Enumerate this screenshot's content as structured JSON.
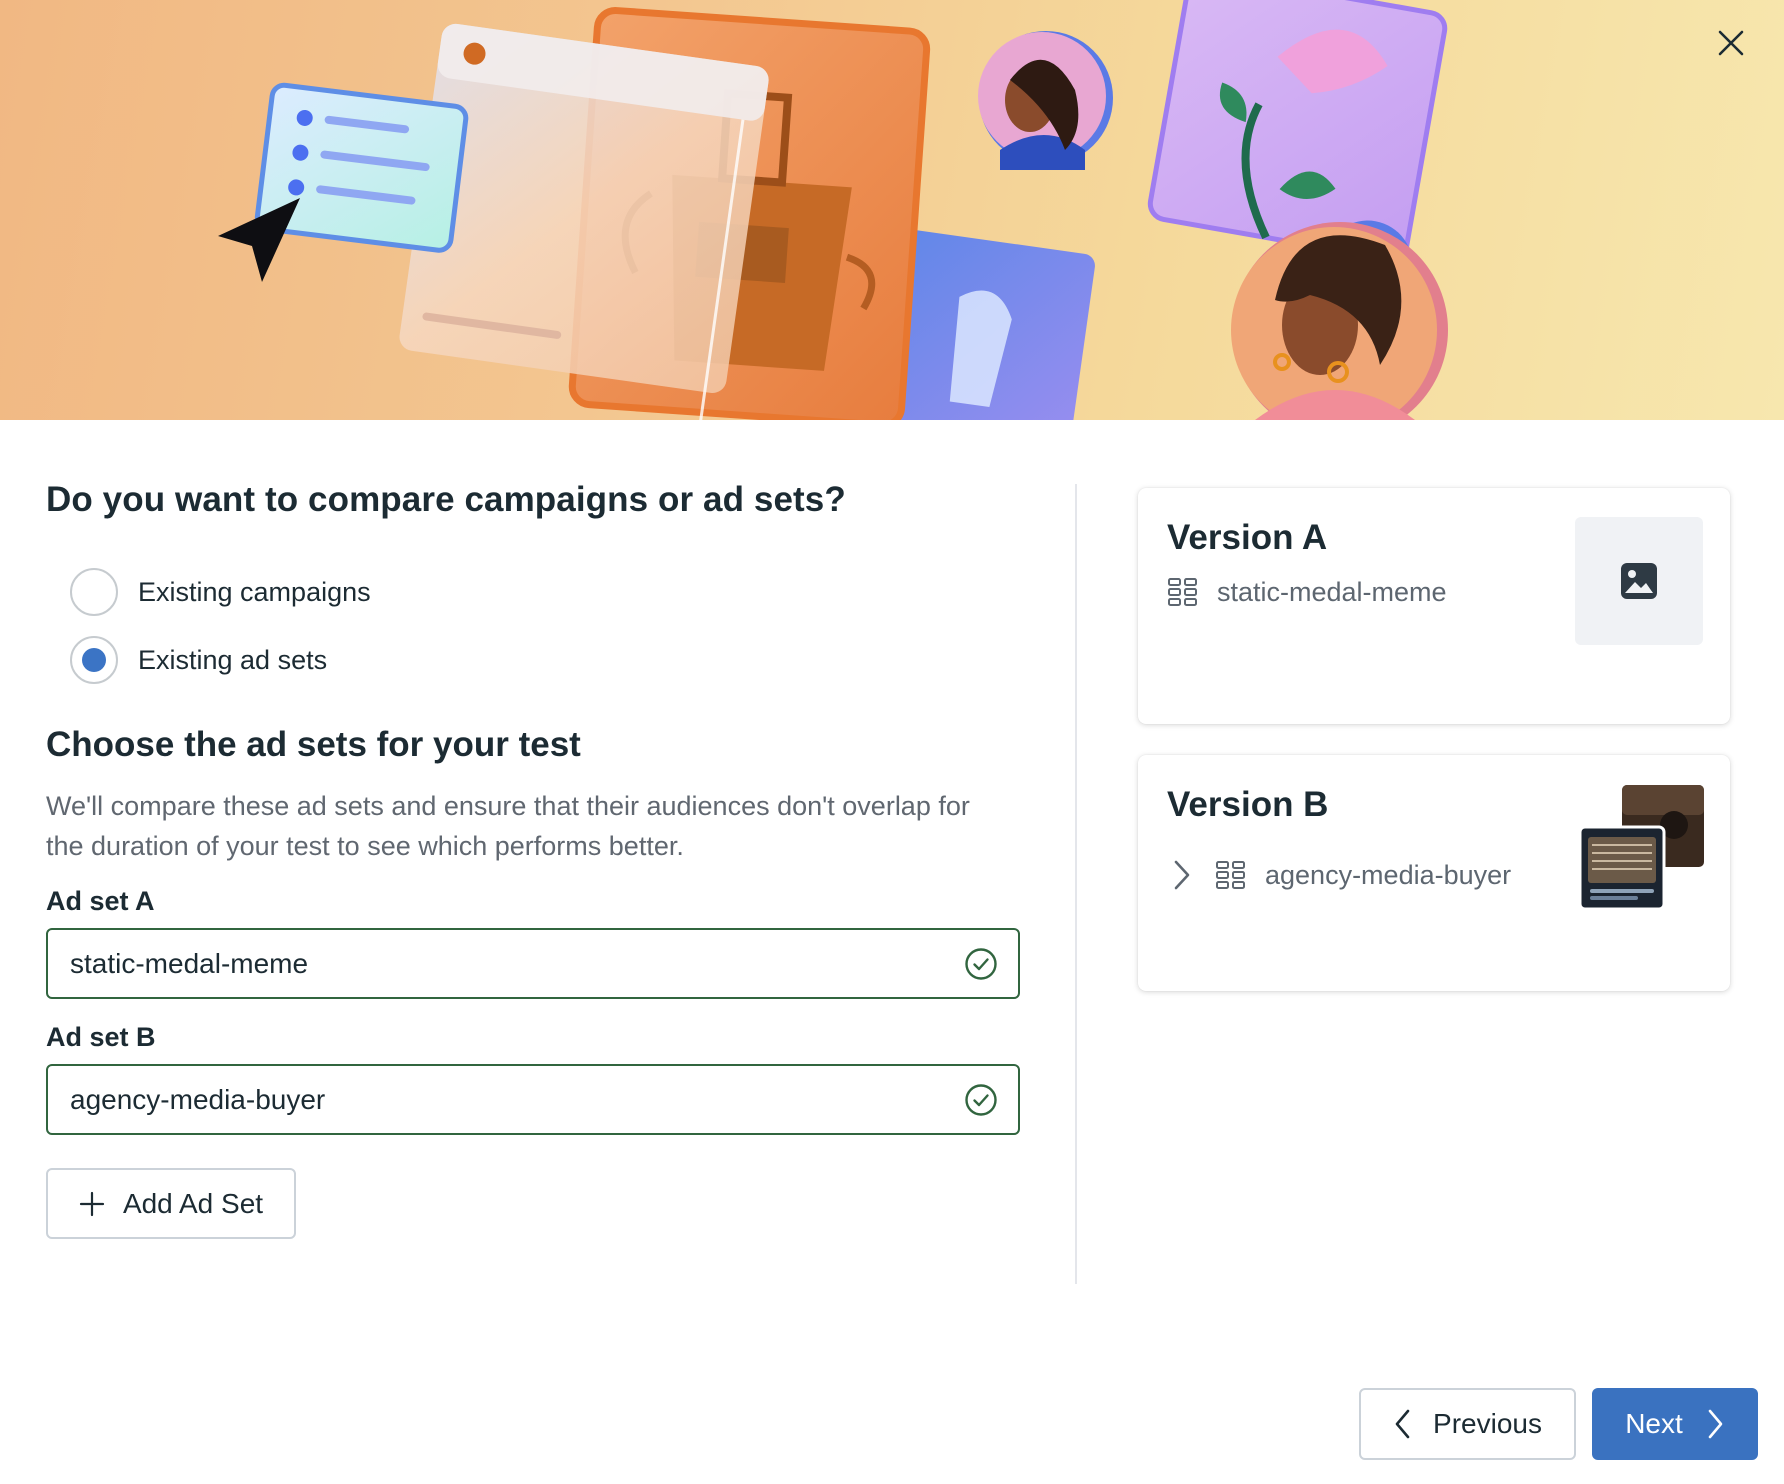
{
  "dialog": {
    "close_icon": "close-icon",
    "hero_illustration": "ad-creative-illustration"
  },
  "compare": {
    "question": "Do you want to compare campaigns or ad sets?",
    "options": [
      {
        "label": "Existing campaigns",
        "selected": false
      },
      {
        "label": "Existing ad sets",
        "selected": true
      }
    ]
  },
  "choose": {
    "title": "Choose the ad sets for your test",
    "description": "We'll compare these ad sets and ensure that their audiences don't overlap for the duration of your test to see which performs better.",
    "ad_set_a_label": "Ad set A",
    "ad_set_a_value": "static-medal-meme",
    "ad_set_b_label": "Ad set B",
    "ad_set_b_value": "agency-media-buyer",
    "valid_icon": "check-circle-icon",
    "add_button_label": "Add Ad Set",
    "add_icon": "plus-icon"
  },
  "versions": [
    {
      "title": "Version A",
      "ad_set": "static-medal-meme",
      "icon": "ad-set-grid-icon",
      "thumbnail": "image-placeholder-icon"
    },
    {
      "title": "Version B",
      "ad_set": "agency-media-buyer",
      "icon": "ad-set-grid-icon",
      "expand_icon": "chevron-right-icon",
      "thumbnail": "stacked-ad-thumbnails"
    }
  ],
  "footer": {
    "previous_label": "Previous",
    "next_label": "Next"
  },
  "colors": {
    "primary": "#3a72c0",
    "valid_border": "#31653f",
    "radio_selected": "#3b74c5",
    "text": "#1c2b33",
    "muted_text": "#606770"
  }
}
